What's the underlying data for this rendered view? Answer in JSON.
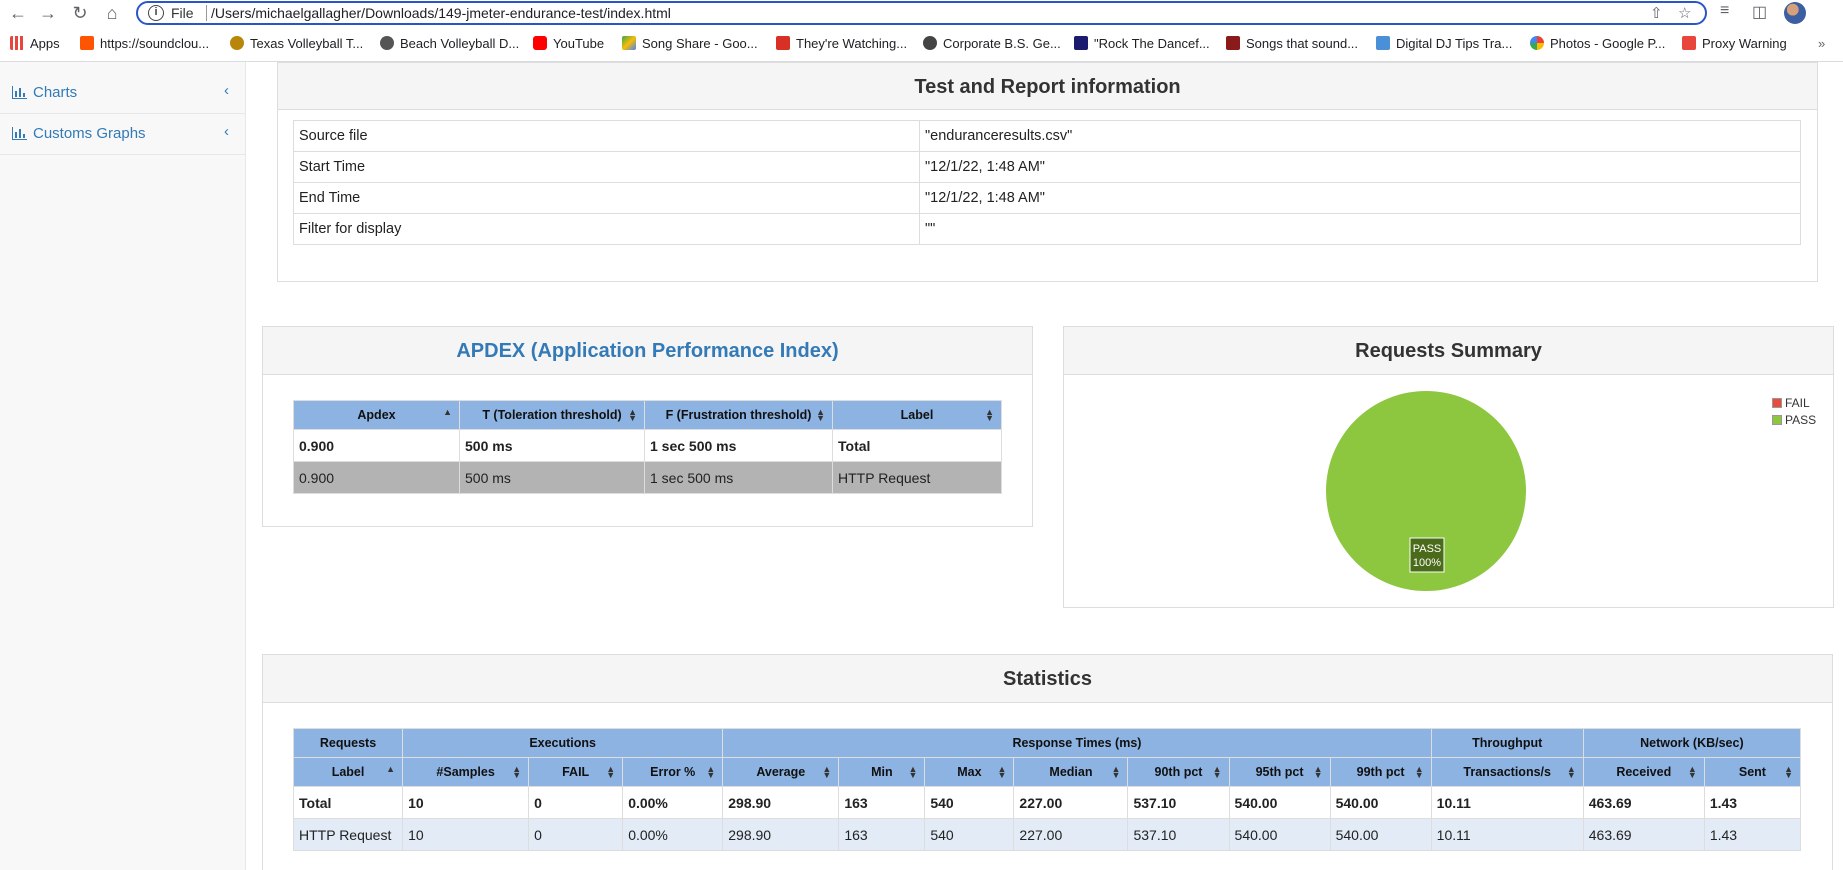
{
  "browser": {
    "file_label": "File",
    "url": "/Users/michaelgallagher/Downloads/149-jmeter-endurance-test/index.html",
    "bookmarks": [
      {
        "label": "Apps",
        "color": "#e8453c"
      },
      {
        "label": "https://soundclou...",
        "color": "#ff5500"
      },
      {
        "label": "Texas Volleyball T...",
        "color": "#b8860b"
      },
      {
        "label": "Beach Volleyball D...",
        "color": "#555555"
      },
      {
        "label": "YouTube",
        "color": "#ff0000"
      },
      {
        "label": "Song Share - Goo...",
        "color": "#fbbc04"
      },
      {
        "label": "They're Watching...",
        "color": "#d93025"
      },
      {
        "label": "Corporate B.S. Ge...",
        "color": "#444444"
      },
      {
        "label": "\"Rock The Dancef...",
        "color": "#1a1a6e"
      },
      {
        "label": "Songs that sound...",
        "color": "#8b1a1a"
      },
      {
        "label": "Digital DJ Tips Tra...",
        "color": "#4a90d9"
      },
      {
        "label": "Photos - Google P...",
        "color": "#34a853"
      },
      {
        "label": "Proxy Warning",
        "color": "#e8453c"
      }
    ]
  },
  "sidebar": {
    "items": [
      {
        "label": "Charts"
      },
      {
        "label": "Customs Graphs"
      }
    ]
  },
  "test_info": {
    "title": "Test and Report information",
    "rows": [
      {
        "key": "Source file",
        "value": "\"enduranceresults.csv\""
      },
      {
        "key": "Start Time",
        "value": "\"12/1/22, 1:48 AM\""
      },
      {
        "key": "End Time",
        "value": "\"12/1/22, 1:48 AM\""
      },
      {
        "key": "Filter for display",
        "value": "\"\""
      }
    ]
  },
  "apdex": {
    "title": "APDEX (Application Performance Index)",
    "headers": [
      "Apdex",
      "T (Toleration threshold)",
      "F (Frustration threshold)",
      "Label"
    ],
    "rows": [
      [
        "0.900",
        "500 ms",
        "1 sec 500 ms",
        "Total"
      ],
      [
        "0.900",
        "500 ms",
        "1 sec 500 ms",
        "HTTP Request"
      ]
    ]
  },
  "requests_summary": {
    "title": "Requests Summary",
    "legend": [
      {
        "label": "FAIL",
        "color": "#e74c3c"
      },
      {
        "label": "PASS",
        "color": "#8dc63f"
      }
    ],
    "slice_label": "PASS",
    "slice_percent": "100%",
    "pass_color": "#8dc63f"
  },
  "chart_data": {
    "type": "pie",
    "title": "Requests Summary",
    "categories": [
      "FAIL",
      "PASS"
    ],
    "values": [
      0,
      100
    ]
  },
  "statistics": {
    "title": "Statistics",
    "group_headers": [
      "Requests",
      "Executions",
      "Response Times (ms)",
      "Throughput",
      "Network (KB/sec)"
    ],
    "headers": [
      "Label",
      "#Samples",
      "FAIL",
      "Error %",
      "Average",
      "Min",
      "Max",
      "Median",
      "90th pct",
      "95th pct",
      "99th pct",
      "Transactions/s",
      "Received",
      "Sent"
    ],
    "rows": [
      [
        "Total",
        "10",
        "0",
        "0.00%",
        "298.90",
        "163",
        "540",
        "227.00",
        "537.10",
        "540.00",
        "540.00",
        "10.11",
        "463.69",
        "1.43"
      ],
      [
        "HTTP Request",
        "10",
        "0",
        "0.00%",
        "298.90",
        "163",
        "540",
        "227.00",
        "537.10",
        "540.00",
        "540.00",
        "10.11",
        "463.69",
        "1.43"
      ]
    ]
  }
}
